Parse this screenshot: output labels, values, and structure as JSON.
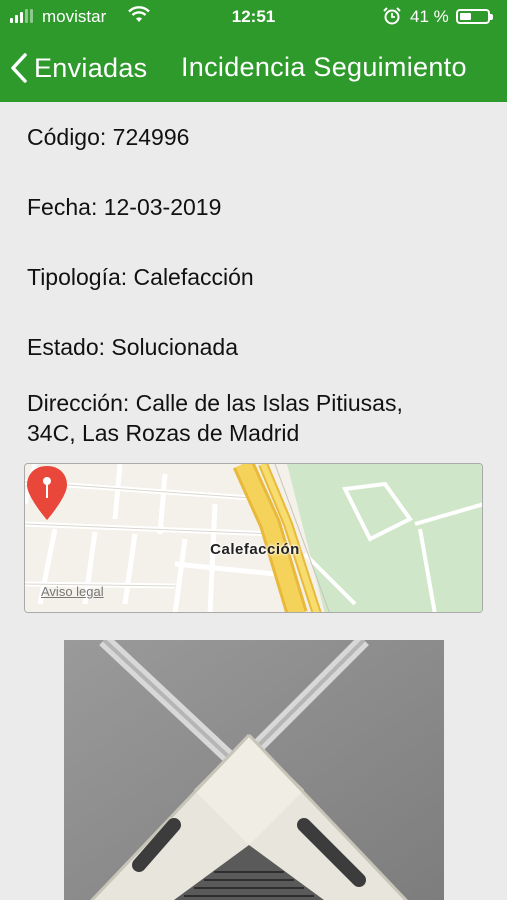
{
  "status_bar": {
    "carrier": "movistar",
    "time": "12:51",
    "battery_percent": "41 %",
    "battery_level": 0.41,
    "icons": [
      "signal-icon",
      "wifi-icon",
      "alarm-icon",
      "battery-icon"
    ]
  },
  "nav": {
    "back_label": "Enviadas",
    "title": "Incidencia Seguimiento"
  },
  "incident": {
    "codigo_label": "Código",
    "codigo": "724996",
    "fecha_label": "Fecha",
    "fecha": "12-03-2019",
    "tipologia_label": "Tipología",
    "tipologia": "Calefacción",
    "estado_label": "Estado",
    "estado": "Solucionada",
    "direccion_label": "Dirección",
    "direccion_line1": "Calle de las Islas Pitiusas,",
    "direccion_line2": "34C, Las Rozas de Madrid"
  },
  "map": {
    "pin_label": "Calefacción",
    "legal_link": "Aviso legal",
    "colors": {
      "road": "#f5c842",
      "park": "#cfe7c8",
      "land": "#f4f1ea",
      "pin": "#e8473a"
    }
  },
  "colors": {
    "accent": "#2f9a2c",
    "background": "#ebebeb"
  }
}
